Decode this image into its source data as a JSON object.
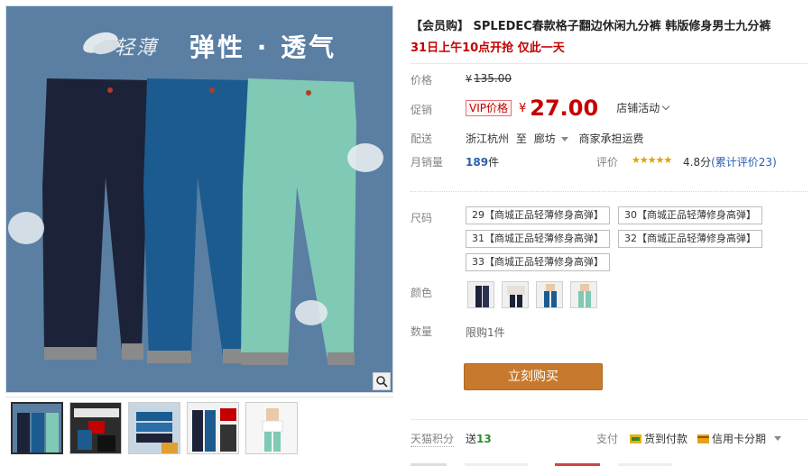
{
  "banner": {
    "light_text": "轻薄",
    "bold_text": "弹性 · 透气"
  },
  "product": {
    "title": "【会员购】 SPLEDEC春款格子翻边休闲九分裤 韩版修身男士九分裤",
    "subtitle": "31日上午10点开抢 仅此一天"
  },
  "price_row": {
    "label": "价格",
    "currency": "¥",
    "original": "135.00"
  },
  "promo_row": {
    "label": "促销",
    "vip_tag": "VIP价格",
    "currency": "¥",
    "price": "27.00",
    "store_activity": "店铺活动"
  },
  "shipping": {
    "label": "配送",
    "from": "浙江杭州",
    "to_word": "至",
    "to": "廊坊",
    "note": "商家承担运费"
  },
  "sales": {
    "label": "月销量",
    "count": "189",
    "unit": "件",
    "rating_label": "评价",
    "stars": "★★★★★",
    "score": "4.8分",
    "count_text": "(累计评价",
    "count_num": "23",
    "count_close": ")"
  },
  "sizes": {
    "label": "尺码",
    "options": [
      "29【商城正品轻薄修身高弹】",
      "30【商城正品轻薄修身高弹】",
      "31【商城正品轻薄修身高弹】",
      "32【商城正品轻薄修身高弹】",
      "33【商城正品轻薄修身高弹】"
    ]
  },
  "colors": {
    "label": "颜色",
    "count": 4
  },
  "quantity": {
    "label": "数量",
    "limit": "限购1件"
  },
  "buy_button": "立刻购买",
  "bottom": {
    "points_label": "天猫积分",
    "points_prefix": "送",
    "points": "13",
    "pay_label": "支付",
    "pay1": "货到付款",
    "pay2": "信用卡分期"
  },
  "colors_theme": {
    "price_red": "#c40000",
    "buy_button": "#c7792d",
    "gallery_bg": "#5a7fa3"
  }
}
